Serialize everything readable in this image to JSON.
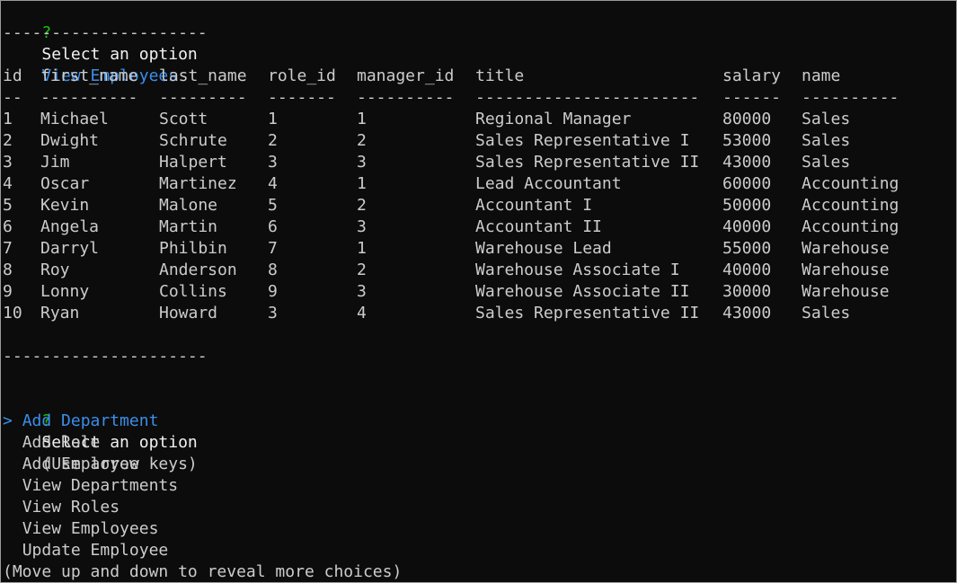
{
  "colors": {
    "background": "#0c0c0c",
    "text": "#cccccc",
    "bright_text": "#f2f2f2",
    "question_mark": "#16c60c",
    "accent": "#3b8eea"
  },
  "prompt1": {
    "mark": "?",
    "question": "Select an option",
    "answer": "View Employees"
  },
  "separator_top": "---------------------",
  "table": {
    "headers": [
      "id",
      "first_name",
      "last_name",
      "role_id",
      "manager_id",
      "title",
      "salary",
      "name"
    ],
    "underlines": [
      "--",
      "----------",
      "---------",
      "-------",
      "----------",
      "-----------------------",
      "------",
      "----------"
    ],
    "rows": [
      [
        "1",
        "Michael",
        "Scott",
        "1",
        "1",
        "Regional Manager",
        "80000",
        "Sales"
      ],
      [
        "2",
        "Dwight",
        "Schrute",
        "2",
        "2",
        "Sales Representative I",
        "53000",
        "Sales"
      ],
      [
        "3",
        "Jim",
        "Halpert",
        "3",
        "3",
        "Sales Representative II",
        "43000",
        "Sales"
      ],
      [
        "4",
        "Oscar",
        "Martinez",
        "4",
        "1",
        "Lead Accountant",
        "60000",
        "Accounting"
      ],
      [
        "5",
        "Kevin",
        "Malone",
        "5",
        "2",
        "Accountant I",
        "50000",
        "Accounting"
      ],
      [
        "6",
        "Angela",
        "Martin",
        "6",
        "3",
        "Accountant II",
        "40000",
        "Accounting"
      ],
      [
        "7",
        "Darryl",
        "Philbin",
        "7",
        "1",
        "Warehouse Lead",
        "55000",
        "Warehouse"
      ],
      [
        "8",
        "Roy",
        "Anderson",
        "8",
        "2",
        "Warehouse Associate I",
        "40000",
        "Warehouse"
      ],
      [
        "9",
        "Lonny",
        "Collins",
        "9",
        "3",
        "Warehouse Associate II",
        "30000",
        "Warehouse"
      ],
      [
        "10",
        "Ryan",
        "Howard",
        "3",
        "4",
        "Sales Representative II",
        "43000",
        "Sales"
      ]
    ]
  },
  "separator_bottom": "---------------------",
  "prompt2": {
    "mark": "?",
    "question": "Select an option",
    "hint": "(Use arrow keys)"
  },
  "menu": {
    "pointer": ">",
    "items": [
      "Add Department",
      "Add Role",
      "Add Employee",
      "View Departments",
      "View Roles",
      "View Employees",
      "Update Employee"
    ],
    "selected_index": 0
  },
  "footer_hint": "(Move up and down to reveal more choices)"
}
